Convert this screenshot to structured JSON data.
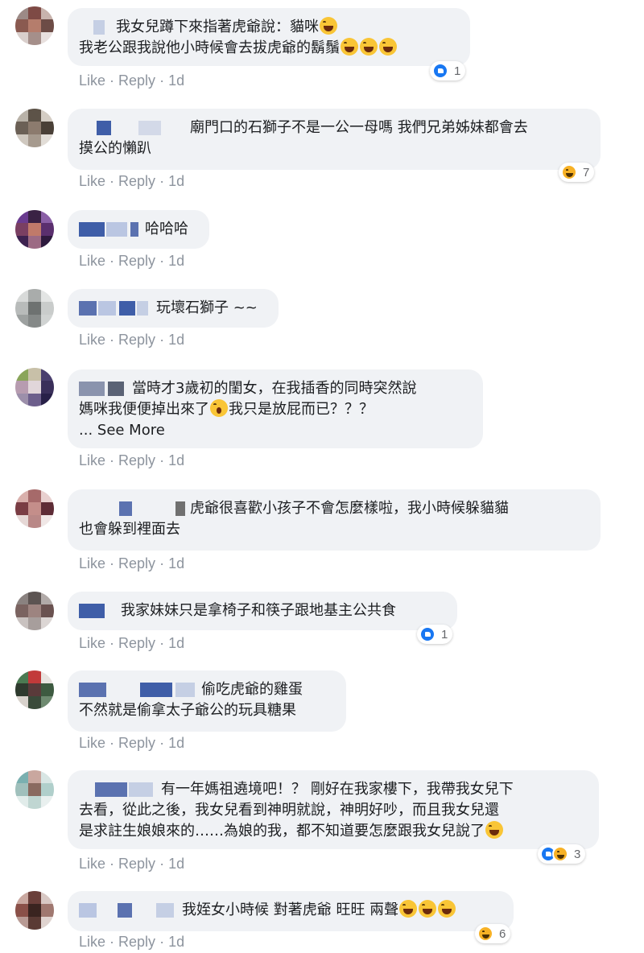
{
  "colors": {
    "bubble": "#f0f2f5",
    "meta": "#8d949e",
    "like_blue": "#1877f2",
    "haha_yellow": "#f7b125"
  },
  "actions": {
    "like": "Like",
    "separator": "·",
    "reply": "Reply",
    "time": "1d"
  },
  "comments": [
    {
      "lines": [
        "我女兒蹲下來指著虎爺說：貓咪",
        "我老公跟我說他小時候會去拔虎爺的鬍鬚"
      ],
      "emojis": [
        "laughing-face-emoji",
        "laughing-face-emoji"
      ],
      "reactions": {
        "types": [
          "like"
        ],
        "count": "1"
      }
    },
    {
      "lines": [
        "廟門口的石獅子不是一公一母嗎 我們兄弟姊妹都會去",
        "摸公的懶趴"
      ],
      "reactions": {
        "types": [
          "haha"
        ],
        "count": "7"
      }
    },
    {
      "lines": [
        "哈哈哈"
      ]
    },
    {
      "lines": [
        "玩壞石獅子 ~~"
      ]
    },
    {
      "lines": [
        "當時才3歲初的閨女，在我插香的同時突然說",
        "媽咪我便便掉出來了",
        "我只是放屁而已？？？"
      ],
      "see_more": "... See More"
    },
    {
      "lines": [
        "虎爺很喜歡小孩子不會怎麼樣啦，我小時候躲貓貓",
        "也會躲到裡面去"
      ]
    },
    {
      "lines": [
        "我家妹妹只是拿椅子和筷子跟地基主公共食"
      ],
      "reactions": {
        "types": [
          "like"
        ],
        "count": "1"
      }
    },
    {
      "lines": [
        "偷吃虎爺的雞蛋",
        "不然就是偷拿太子爺公的玩具糖果"
      ]
    },
    {
      "lines": [
        "有一年媽祖遶境吧！？ 剛好在我家樓下，我帶我女兒下",
        "去看，從此之後，我女兒看到神明就說，神明好吵，而且我女兒還",
        "是求註生娘娘來的……為娘的我，都不知道要怎麼跟我女兒說了"
      ],
      "reactions": {
        "types": [
          "like",
          "haha"
        ],
        "count": "3"
      }
    },
    {
      "lines": [
        "我姪女小時候 對著虎爺 旺旺 兩聲"
      ],
      "reactions": {
        "types": [
          "haha"
        ],
        "count": "6"
      }
    }
  ]
}
